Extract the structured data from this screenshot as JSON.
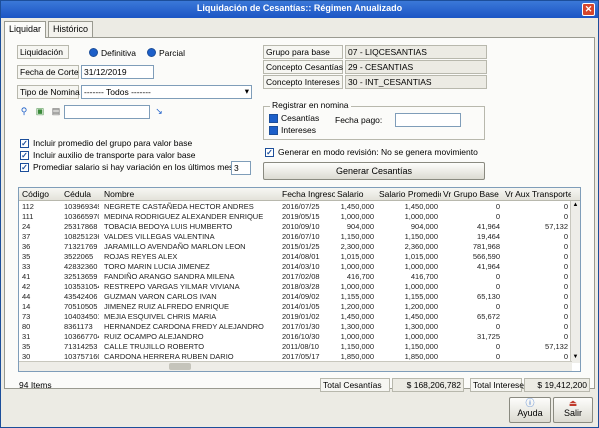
{
  "window": {
    "title": "Liquidación de Cesantías:: Régimen Anualizado"
  },
  "tabs": [
    {
      "label": "Liquidar"
    },
    {
      "label": "Histórico"
    }
  ],
  "form": {
    "liquidacion_label": "Liquidación",
    "radio_definitiva": "Definitiva",
    "radio_parcial": "Parcial",
    "fecha_corte_label": "Fecha de Corte",
    "fecha_corte_value": "31/12/2019",
    "tipo_nomina_label": "Tipo de Nomina",
    "tipo_nomina_value": "------- Todos -------",
    "grupo_base_label": "Grupo para base",
    "grupo_base_value": "07 - LIQCESANTIAS",
    "concepto_cesantias_label": "Concepto Cesantías",
    "concepto_cesantias_value": "29 - CESANTIAS",
    "concepto_intereses_label": "Concepto Intereses",
    "concepto_intereses_value": "30 - INT_CESANTIAS",
    "registrar_title": "Registrar en nomina",
    "registrar_cesantias": "Cesantías",
    "registrar_intereses": "Intereses",
    "fecha_pago_label": "Fecha pago:",
    "check_incluir_promedio": "Incluir promedio del grupo para valor base",
    "check_incluir_auxilio": "Incluir auxilio de transporte para valor base",
    "check_promediar": "Promediar salario si hay variación en los últimos meses",
    "meses_value": "3",
    "check_revision": "Generar en modo revisión: No se genera movimiento",
    "generar_button": "Generar Cesantías"
  },
  "grid": {
    "columns": [
      "Código",
      "Cédula",
      "Nombre",
      "Fecha Ingreso",
      "Salario",
      "Salario Promedio",
      "Vr Grupo Base",
      "Vr Aux Transporte"
    ],
    "rows": [
      [
        "112",
        "1039693497",
        "NEGRETE CASTAÑEDA HECTOR ANDRES",
        "2016/07/25",
        "1,450,000",
        "1,450,000",
        "0",
        "0"
      ],
      [
        "111",
        "1036659700",
        "MEDINA RODRIGUEZ ALEXANDER ENRIQUE",
        "2019/05/15",
        "1,000,000",
        "1,000,000",
        "0",
        "0"
      ],
      [
        "24",
        "25317868",
        "TOBACIA BEDOYA LUIS HUMBERTO",
        "2010/09/10",
        "904,000",
        "904,000",
        "41,964",
        "57,132"
      ],
      [
        "37",
        "1082512365",
        "VALDES VILLEGAS VALENTINA",
        "2016/07/10",
        "1,150,000",
        "1,150,000",
        "19,464",
        "0"
      ],
      [
        "36",
        "71321769",
        "JARAMILLO AVENDAÑO MARLON LEON",
        "2015/01/25",
        "2,300,000",
        "2,360,000",
        "781,968",
        "0"
      ],
      [
        "35",
        "3522065",
        "ROJAS REYES ALEX",
        "2014/08/01",
        "1,015,000",
        "1,015,000",
        "566,590",
        "0"
      ],
      [
        "33",
        "42832360",
        "TORO MARIN LUCIA JIMENEZ",
        "2014/03/10",
        "1,000,000",
        "1,000,000",
        "41,964",
        "0"
      ],
      [
        "41",
        "32513659",
        "FANDIÑO ARANGO SANDRA MILENA",
        "2017/02/08",
        "416,700",
        "416,700",
        "0",
        "0"
      ],
      [
        "42",
        "1035310540",
        "RESTREPO VARGAS YILMAR VIVIANA",
        "2018/03/28",
        "1,000,000",
        "1,000,000",
        "0",
        "0"
      ],
      [
        "44",
        "43542406",
        "GUZMAN VARON CARLOS IVAN",
        "2014/09/02",
        "1,155,000",
        "1,155,000",
        "65,130",
        "0"
      ],
      [
        "14",
        "70510505",
        "JIMENEZ RUIZ ALFREDO ENRIQUE",
        "2014/01/05",
        "1,200,000",
        "1,200,000",
        "0",
        "0"
      ],
      [
        "73",
        "1040345012",
        "MEJIA ESQUIVEL CHRIS MARIA",
        "2019/01/02",
        "1,450,000",
        "1,450,000",
        "65,672",
        "0"
      ],
      [
        "80",
        "8361173",
        "HERNANDEZ CARDONA FREDY ALEJANDRO",
        "2017/01/30",
        "1,300,000",
        "1,300,000",
        "0",
        "0"
      ],
      [
        "31",
        "1036677040",
        "RUIZ OCAMPO ALEJANDRO",
        "2016/10/30",
        "1,000,000",
        "1,000,000",
        "31,725",
        "0"
      ],
      [
        "35",
        "71314253",
        "CALLE TRUJILLO ROBERTO",
        "2011/08/10",
        "1,150,000",
        "1,150,000",
        "0",
        "57,132"
      ],
      [
        "30",
        "1037571600",
        "CARDONA HERRERA RUBEN DARIO",
        "2017/05/17",
        "1,850,000",
        "1,850,000",
        "0",
        "0"
      ]
    ]
  },
  "footer": {
    "items_count": "94 Items",
    "total_cesantias_label": "Total Cesantías",
    "total_cesantias_value": "$ 168,206,782",
    "total_intereses_label": "Total Intereses",
    "total_intereses_value": "$ 19,412,200",
    "ayuda_button": "Ayuda",
    "salir_button": "Salir"
  },
  "icons": {
    "close": "close-icon",
    "search": "search-icon",
    "image": "image-icon",
    "document": "document-icon",
    "arrow": "arrow-down-right-icon",
    "help": "help-icon",
    "exit": "exit-icon"
  }
}
